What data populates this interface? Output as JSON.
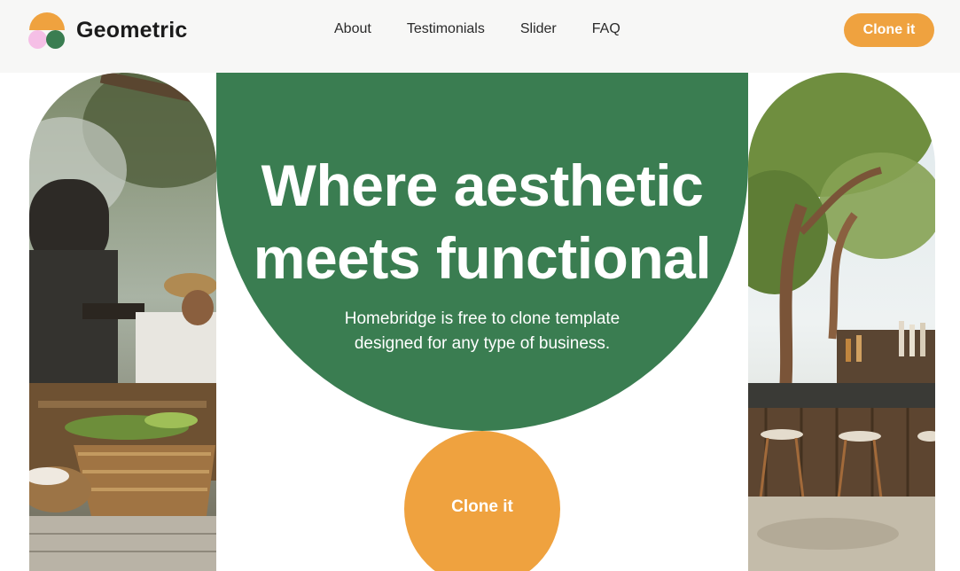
{
  "colors": {
    "green": "#3a7d51",
    "orange": "#efa23f",
    "pink": "#f5bfe6",
    "header_bg": "#f7f7f6"
  },
  "header": {
    "brand": "Geometric",
    "nav": [
      {
        "label": "About"
      },
      {
        "label": "Testimonials"
      },
      {
        "label": "Slider"
      },
      {
        "label": "FAQ"
      }
    ],
    "cta_label": "Clone it"
  },
  "hero": {
    "title_line1": "Where aesthetic",
    "title_line2": "meets functional",
    "subtitle_line1": "Homebridge is free to clone template",
    "subtitle_line2": "designed for any type of business.",
    "cta_label": "Clone it"
  },
  "images": {
    "left": "outdoor-kitchen-photo",
    "right": "garden-bar-photo"
  }
}
